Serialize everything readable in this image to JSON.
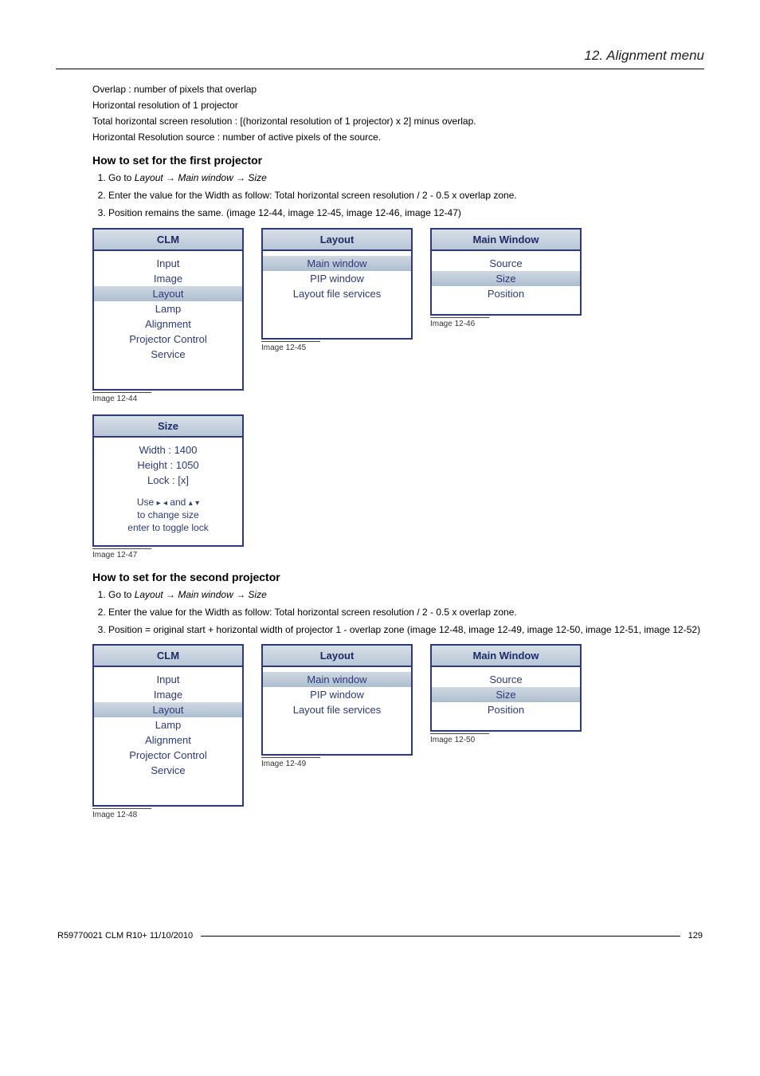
{
  "header": {
    "section_title": "12.  Alignment menu"
  },
  "intro": {
    "p1": "Overlap :  number of pixels that overlap",
    "p2": "Horizontal resolution of 1 projector",
    "p3": "Total horizontal screen resolution :  [(horizontal resolution of 1 projector) x 2] minus overlap.",
    "p4": "Horizontal Resolution source :  number of active pixels of the source."
  },
  "section1": {
    "heading": "How to set for the first projector",
    "steps": {
      "s1_pre": "Go to ",
      "s1_path": "Layout → Main window → Size",
      "s2": "Enter the value for the Width as follow:  Total horizontal screen resolution / 2 - 0.5 x overlap zone.",
      "s3": "Position remains the same. (image 12-44, image 12-45, image 12-46, image 12-47)"
    },
    "menus": {
      "clm": {
        "title": "CLM",
        "items": [
          "Input",
          "Image",
          "Layout",
          "Lamp",
          "Alignment",
          "Projector Control",
          "Service"
        ],
        "selected": "Layout",
        "caption": "Image 12-44"
      },
      "layout": {
        "title": "Layout",
        "items": [
          "Main window",
          "PIP window",
          "Layout file services"
        ],
        "selected": "Main window",
        "caption": "Image 12-45"
      },
      "mainwin": {
        "title": "Main Window",
        "items": [
          "Source",
          "Size",
          "Position"
        ],
        "selected": "Size",
        "caption": "Image 12-46"
      },
      "size": {
        "title": "Size",
        "values": {
          "width": "Width : 1400",
          "height": "Height : 1050",
          "lock": "Lock : [x]"
        },
        "hint1_pre": "Use ",
        "hint1_mid": " and ",
        "hint2": "to change size",
        "hint3": "enter to toggle lock",
        "caption": "Image 12-47"
      }
    }
  },
  "section2": {
    "heading": "How to set for the second projector",
    "steps": {
      "s1_pre": "Go to ",
      "s1_path": "Layout → Main window → Size",
      "s2": "Enter the value for the Width as follow:  Total horizontal screen resolution / 2 - 0.5 x overlap zone.",
      "s3": "Position = original start + horizontal width of projector 1 - overlap zone (image 12-48, image 12-49, image 12-50, image 12-51, image 12-52)"
    },
    "menus": {
      "clm": {
        "title": "CLM",
        "items": [
          "Input",
          "Image",
          "Layout",
          "Lamp",
          "Alignment",
          "Projector Control",
          "Service"
        ],
        "selected": "Layout",
        "caption": "Image 12-48"
      },
      "layout": {
        "title": "Layout",
        "items": [
          "Main window",
          "PIP window",
          "Layout file services"
        ],
        "selected": "Main window",
        "caption": "Image 12-49"
      },
      "mainwin": {
        "title": "Main Window",
        "items": [
          "Source",
          "Size",
          "Position"
        ],
        "selected": "Size",
        "caption": "Image 12-50"
      }
    }
  },
  "footer": {
    "left": "R59770021  CLM R10+  11/10/2010",
    "right": "129"
  }
}
